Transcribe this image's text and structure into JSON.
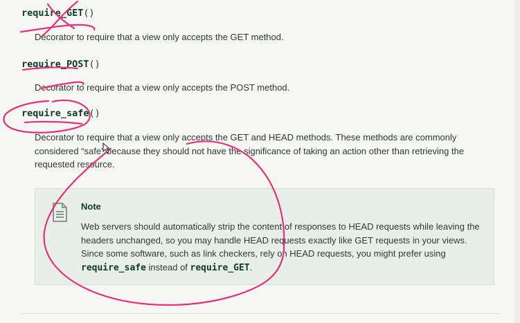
{
  "sections": [
    {
      "name": "require_GET",
      "paren": "()",
      "description": "Decorator to require that a view only accepts the GET method."
    },
    {
      "name": "require_POST",
      "paren": "()",
      "description": "Decorator to require that a view only accepts the POST method."
    },
    {
      "name": "require_safe",
      "paren": "()",
      "description": "Decorator to require that a view only accepts the GET and HEAD methods. These methods are commonly considered “safe” because they should not have the significance of taking an action other than retrieving the requested resource."
    }
  ],
  "note": {
    "title": "Note",
    "text_before": "Web servers should automatically strip the content of responses to HEAD requests while leaving the headers unchanged, so you may handle HEAD requests exactly like GET requests in your views. Since some software, such as link checkers, rely on HEAD requests, you might prefer using ",
    "code_1": "require_safe",
    "text_middle": " instead of ",
    "code_2": "require_GET",
    "text_after": "."
  },
  "icons": {
    "note": "document-icon",
    "cursor": "move-cursor-icon"
  },
  "colors": {
    "annotation_ink": "#e8307a",
    "note_background": "#e8efe9",
    "signature_text": "#0c3c26"
  }
}
